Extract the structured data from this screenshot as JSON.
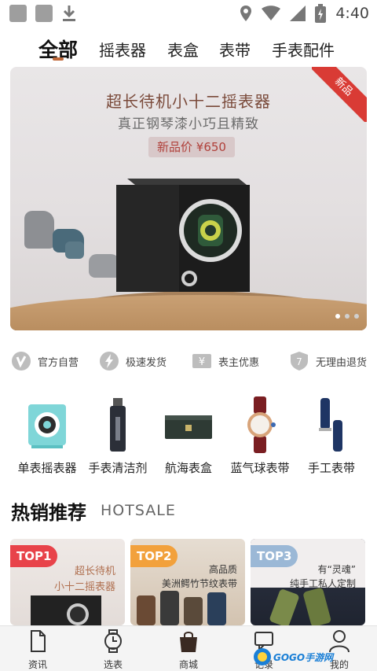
{
  "status_bar": {
    "time": "4:40"
  },
  "category_tabs": [
    "全部",
    "摇表器",
    "表盒",
    "表带",
    "手表配件"
  ],
  "banner": {
    "title": "超长待机小十二摇表器",
    "subtitle": "真正钢琴漆小巧且精致",
    "price": "新品价 ¥650",
    "corner_badge": "新品"
  },
  "features": [
    "官方自营",
    "极速发货",
    "表主优惠",
    "无理由退货"
  ],
  "products": [
    "单表摇表器",
    "手表清洁剂",
    "航海表盒",
    "蓝气球表带",
    "手工表带"
  ],
  "hotsale": {
    "title": "热销推荐",
    "subtitle": "HOTSALE",
    "cards": [
      {
        "badge": "TOP1",
        "line1": "超长待机",
        "line2": "小十二摇表器",
        "badge_color": "#e8434a"
      },
      {
        "badge": "TOP2",
        "line1": "高品质",
        "line2": "美洲鳄竹节纹表带",
        "badge_color": "#f2a13c"
      },
      {
        "badge": "TOP3",
        "line1": "有“灵魂”",
        "line2": "纯手工私人定制",
        "badge_color": "#9bb8d6"
      }
    ]
  },
  "bottom_nav": [
    "资讯",
    "选表",
    "商城",
    "记录",
    "我的"
  ],
  "watermark": "GOGO手游网"
}
